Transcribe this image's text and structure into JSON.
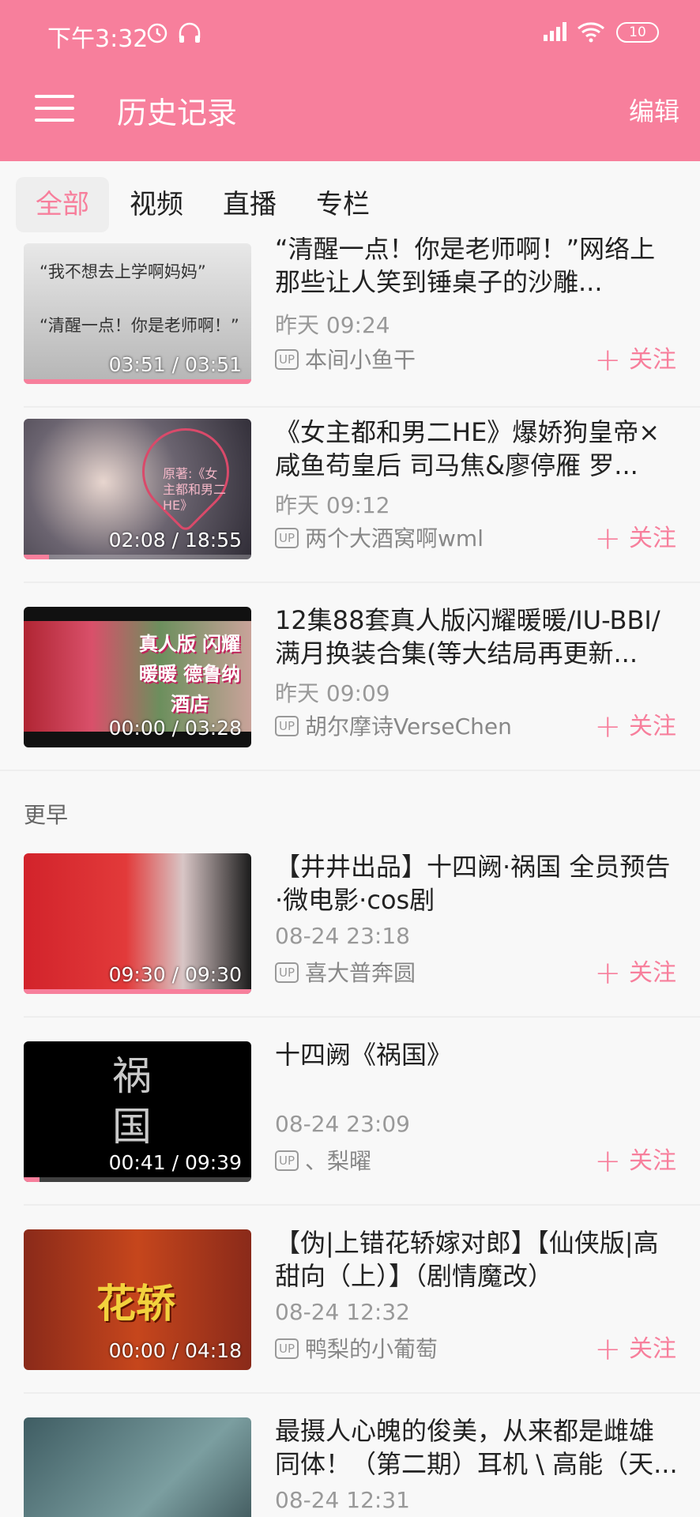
{
  "status": {
    "time": "下午3:32",
    "battery": "10"
  },
  "appbar": {
    "title": "历史记录",
    "edit": "编辑"
  },
  "tabs": [
    {
      "label": "全部",
      "active": true
    },
    {
      "label": "视频",
      "active": false
    },
    {
      "label": "直播",
      "active": false
    },
    {
      "label": "专栏",
      "active": false
    }
  ],
  "follow_label": "关注",
  "up_badge": "UP",
  "section_earlier": "更早",
  "thumb_texts": {
    "item0_line1": "“我不想去上学啊妈妈”",
    "item0_line2": "“清醒一点！你是老师啊！”",
    "item1_overlay": "原著:《女主都和男二HE》",
    "item2_overlay": "真人版 闪耀暖暖 德鲁纳酒店",
    "item5_overlay": "花轿"
  },
  "items": [
    {
      "title": "“清醒一点！你是老师啊！”网络上那些让人笑到锤桌子的沙雕...",
      "date": "昨天 09:24",
      "up": "本间小鱼干",
      "duration": "03:51 / 03:51",
      "progress": 1.0,
      "thumb_color": "#bdbdbd"
    },
    {
      "title": "《女主都和男二HE》爆娇狗皇帝×咸鱼苟皇后  司马焦&廖停雁  罗...",
      "date": "昨天 09:12",
      "up": "两个大酒窝啊wml",
      "duration": "02:08 / 18:55",
      "progress": 0.11,
      "thumb_color": "#5e5e6b"
    },
    {
      "title": "12集88套真人版闪耀暖暖/IU-BBI/满月换装合集(等大结局再更新...",
      "date": "昨天 09:09",
      "up": "胡尔摩诗VerseChen",
      "duration": "00:00 / 03:28",
      "progress": 0.0,
      "thumb_color": "#7a3a3f"
    },
    {
      "title": "【井井出品】十四阙·祸国 全员预告·微电影·cos剧",
      "date": "08-24 23:18",
      "up": "喜大普奔圆",
      "duration": "09:30 / 09:30",
      "progress": 1.0,
      "thumb_color": "#c4282e"
    },
    {
      "title": " 十四阙《祸国》",
      "date": "08-24 23:09",
      "up": "、梨曜",
      "duration": "00:41 / 09:39",
      "progress": 0.07,
      "thumb_color": "#000000"
    },
    {
      "title": "【伪|上错花轿嫁对郎】【仙侠版|高甜向（上）】（剧情魔改）",
      "date": "08-24 12:32",
      "up": "鸭梨的小葡萄",
      "duration": "00:00 / 04:18",
      "progress": 0.0,
      "thumb_color": "#9a2a18"
    },
    {
      "title": "最摄人心魄的俊美，从来都是雌雄同体！（第二期）耳机 \\ 高能（天...",
      "date": "08-24 12:31",
      "up": "",
      "duration": "",
      "progress": 0.0,
      "thumb_color": "#49666b"
    }
  ]
}
